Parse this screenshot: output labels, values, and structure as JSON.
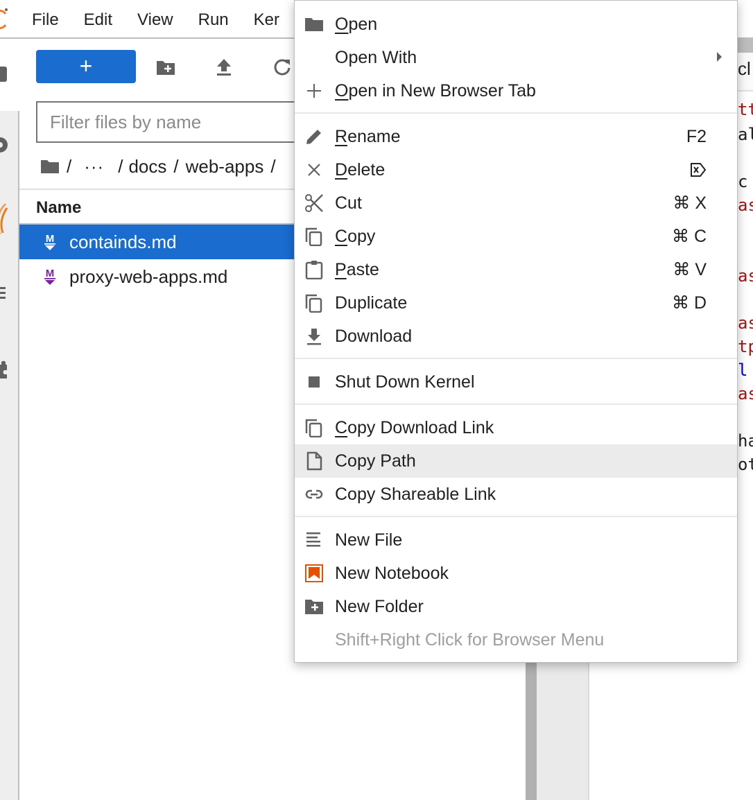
{
  "menubar": {
    "items": [
      "File",
      "Edit",
      "View",
      "Run",
      "Ker"
    ]
  },
  "toolbar": {
    "new_launcher_label": "+",
    "new_folder_icon": "new-folder-icon",
    "upload_icon": "upload-icon",
    "refresh_icon": "refresh-icon"
  },
  "file_browser": {
    "filter_placeholder": "Filter files by name",
    "breadcrumbs": {
      "root": "/",
      "ellipsis": "···",
      "parts": [
        "docs",
        "web-apps"
      ],
      "separator": "/"
    },
    "column_header": "Name",
    "files": [
      {
        "name": "containds.md",
        "icon": "markdown-icon",
        "selected": true
      },
      {
        "name": "proxy-web-apps.md",
        "icon": "markdown-icon",
        "selected": false
      }
    ]
  },
  "right_panel": {
    "tab_fragment": "cl",
    "code_fragments": [
      {
        "text": "tt",
        "color": "red"
      },
      {
        "text": "al",
        "color": "dark"
      },
      {
        "text": " c",
        "color": "dark"
      },
      {
        "text": "as",
        "color": "red"
      },
      {
        "text": "as",
        "color": "red"
      },
      {
        "text": "as",
        "color": "red"
      },
      {
        "text": "tp",
        "color": "red"
      },
      {
        "text": "l",
        "color": "blue"
      },
      {
        "text": "as",
        "color": "red"
      },
      {
        "text": "ha",
        "color": "dark"
      },
      {
        "text": "ot",
        "color": "dark"
      }
    ]
  },
  "context_menu": {
    "items": [
      {
        "id": "open",
        "pre": "",
        "mnemonic": "O",
        "post": "pen",
        "icon": "folder-icon",
        "shortcut": ""
      },
      {
        "id": "open-with",
        "pre": "Open With",
        "mnemonic": "",
        "post": "",
        "icon": "",
        "shortcut": "",
        "submenu": true
      },
      {
        "id": "open-new-tab",
        "pre": "",
        "mnemonic": "O",
        "post": "pen in New Browser Tab",
        "icon": "add-icon",
        "shortcut": ""
      },
      {
        "id": "rename",
        "pre": "",
        "mnemonic": "R",
        "post": "ename",
        "icon": "edit-icon",
        "shortcut": "F2"
      },
      {
        "id": "delete",
        "pre": "",
        "mnemonic": "D",
        "post": "elete",
        "icon": "close-icon",
        "shortcut": "⌦"
      },
      {
        "id": "cut",
        "pre": "Cut",
        "mnemonic": "",
        "post": "",
        "icon": "cut-icon",
        "shortcut": "⌘ X"
      },
      {
        "id": "copy",
        "pre": "",
        "mnemonic": "C",
        "post": "opy",
        "icon": "copy-icon",
        "shortcut": "⌘ C"
      },
      {
        "id": "paste",
        "pre": "",
        "mnemonic": "P",
        "post": "aste",
        "icon": "paste-icon",
        "shortcut": "⌘ V"
      },
      {
        "id": "duplicate",
        "pre": "Duplicate",
        "mnemonic": "",
        "post": "",
        "icon": "duplicate-icon",
        "shortcut": "⌘ D"
      },
      {
        "id": "download",
        "pre": "Download",
        "mnemonic": "",
        "post": "",
        "icon": "download-icon",
        "shortcut": ""
      },
      {
        "id": "shutdown-kernel",
        "pre": "Shut Down Kernel",
        "mnemonic": "",
        "post": "",
        "icon": "stop-icon",
        "shortcut": ""
      },
      {
        "id": "copy-download-link",
        "pre": "",
        "mnemonic": "C",
        "post": "opy Download Link",
        "icon": "copy-icon",
        "shortcut": ""
      },
      {
        "id": "copy-path",
        "pre": "Copy Path",
        "mnemonic": "",
        "post": "",
        "icon": "file-icon",
        "shortcut": "",
        "active": true
      },
      {
        "id": "copy-shareable-link",
        "pre": "Copy Shareable Link",
        "mnemonic": "",
        "post": "",
        "icon": "link-icon",
        "shortcut": ""
      },
      {
        "id": "new-file",
        "pre": "New File",
        "mnemonic": "",
        "post": "",
        "icon": "text-file-icon",
        "shortcut": ""
      },
      {
        "id": "new-notebook",
        "pre": "New Notebook",
        "mnemonic": "",
        "post": "",
        "icon": "notebook-icon",
        "shortcut": ""
      },
      {
        "id": "new-folder",
        "pre": "New Folder",
        "mnemonic": "",
        "post": "",
        "icon": "new-folder-icon",
        "shortcut": ""
      }
    ],
    "hint": "Shift+Right Click for Browser Menu"
  },
  "colors": {
    "accent": "#1a6ccf",
    "markdown_icon": "#7b1fa2",
    "notebook_icon": "#e65100",
    "active_item_bg": "#ebebeb",
    "hint_text": "#9e9e9e"
  }
}
